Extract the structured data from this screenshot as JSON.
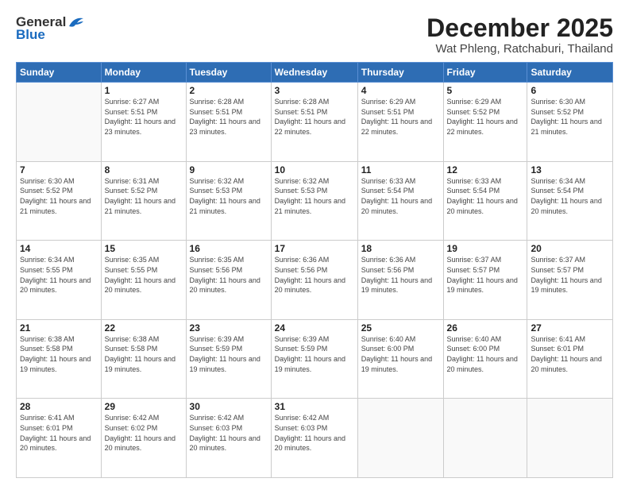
{
  "header": {
    "logo_general": "General",
    "logo_blue": "Blue",
    "month_title": "December 2025",
    "location": "Wat Phleng, Ratchaburi, Thailand"
  },
  "days_of_week": [
    "Sunday",
    "Monday",
    "Tuesday",
    "Wednesday",
    "Thursday",
    "Friday",
    "Saturday"
  ],
  "weeks": [
    [
      {
        "day": "",
        "sunrise": "",
        "sunset": "",
        "daylight": ""
      },
      {
        "day": "1",
        "sunrise": "6:27 AM",
        "sunset": "5:51 PM",
        "daylight": "11 hours and 23 minutes."
      },
      {
        "day": "2",
        "sunrise": "6:28 AM",
        "sunset": "5:51 PM",
        "daylight": "11 hours and 23 minutes."
      },
      {
        "day": "3",
        "sunrise": "6:28 AM",
        "sunset": "5:51 PM",
        "daylight": "11 hours and 22 minutes."
      },
      {
        "day": "4",
        "sunrise": "6:29 AM",
        "sunset": "5:51 PM",
        "daylight": "11 hours and 22 minutes."
      },
      {
        "day": "5",
        "sunrise": "6:29 AM",
        "sunset": "5:52 PM",
        "daylight": "11 hours and 22 minutes."
      },
      {
        "day": "6",
        "sunrise": "6:30 AM",
        "sunset": "5:52 PM",
        "daylight": "11 hours and 21 minutes."
      }
    ],
    [
      {
        "day": "7",
        "sunrise": "6:30 AM",
        "sunset": "5:52 PM",
        "daylight": "11 hours and 21 minutes."
      },
      {
        "day": "8",
        "sunrise": "6:31 AM",
        "sunset": "5:52 PM",
        "daylight": "11 hours and 21 minutes."
      },
      {
        "day": "9",
        "sunrise": "6:32 AM",
        "sunset": "5:53 PM",
        "daylight": "11 hours and 21 minutes."
      },
      {
        "day": "10",
        "sunrise": "6:32 AM",
        "sunset": "5:53 PM",
        "daylight": "11 hours and 21 minutes."
      },
      {
        "day": "11",
        "sunrise": "6:33 AM",
        "sunset": "5:54 PM",
        "daylight": "11 hours and 20 minutes."
      },
      {
        "day": "12",
        "sunrise": "6:33 AM",
        "sunset": "5:54 PM",
        "daylight": "11 hours and 20 minutes."
      },
      {
        "day": "13",
        "sunrise": "6:34 AM",
        "sunset": "5:54 PM",
        "daylight": "11 hours and 20 minutes."
      }
    ],
    [
      {
        "day": "14",
        "sunrise": "6:34 AM",
        "sunset": "5:55 PM",
        "daylight": "11 hours and 20 minutes."
      },
      {
        "day": "15",
        "sunrise": "6:35 AM",
        "sunset": "5:55 PM",
        "daylight": "11 hours and 20 minutes."
      },
      {
        "day": "16",
        "sunrise": "6:35 AM",
        "sunset": "5:56 PM",
        "daylight": "11 hours and 20 minutes."
      },
      {
        "day": "17",
        "sunrise": "6:36 AM",
        "sunset": "5:56 PM",
        "daylight": "11 hours and 20 minutes."
      },
      {
        "day": "18",
        "sunrise": "6:36 AM",
        "sunset": "5:56 PM",
        "daylight": "11 hours and 19 minutes."
      },
      {
        "day": "19",
        "sunrise": "6:37 AM",
        "sunset": "5:57 PM",
        "daylight": "11 hours and 19 minutes."
      },
      {
        "day": "20",
        "sunrise": "6:37 AM",
        "sunset": "5:57 PM",
        "daylight": "11 hours and 19 minutes."
      }
    ],
    [
      {
        "day": "21",
        "sunrise": "6:38 AM",
        "sunset": "5:58 PM",
        "daylight": "11 hours and 19 minutes."
      },
      {
        "day": "22",
        "sunrise": "6:38 AM",
        "sunset": "5:58 PM",
        "daylight": "11 hours and 19 minutes."
      },
      {
        "day": "23",
        "sunrise": "6:39 AM",
        "sunset": "5:59 PM",
        "daylight": "11 hours and 19 minutes."
      },
      {
        "day": "24",
        "sunrise": "6:39 AM",
        "sunset": "5:59 PM",
        "daylight": "11 hours and 19 minutes."
      },
      {
        "day": "25",
        "sunrise": "6:40 AM",
        "sunset": "6:00 PM",
        "daylight": "11 hours and 19 minutes."
      },
      {
        "day": "26",
        "sunrise": "6:40 AM",
        "sunset": "6:00 PM",
        "daylight": "11 hours and 20 minutes."
      },
      {
        "day": "27",
        "sunrise": "6:41 AM",
        "sunset": "6:01 PM",
        "daylight": "11 hours and 20 minutes."
      }
    ],
    [
      {
        "day": "28",
        "sunrise": "6:41 AM",
        "sunset": "6:01 PM",
        "daylight": "11 hours and 20 minutes."
      },
      {
        "day": "29",
        "sunrise": "6:42 AM",
        "sunset": "6:02 PM",
        "daylight": "11 hours and 20 minutes."
      },
      {
        "day": "30",
        "sunrise": "6:42 AM",
        "sunset": "6:03 PM",
        "daylight": "11 hours and 20 minutes."
      },
      {
        "day": "31",
        "sunrise": "6:42 AM",
        "sunset": "6:03 PM",
        "daylight": "11 hours and 20 minutes."
      },
      {
        "day": "",
        "sunrise": "",
        "sunset": "",
        "daylight": ""
      },
      {
        "day": "",
        "sunrise": "",
        "sunset": "",
        "daylight": ""
      },
      {
        "day": "",
        "sunrise": "",
        "sunset": "",
        "daylight": ""
      }
    ]
  ]
}
